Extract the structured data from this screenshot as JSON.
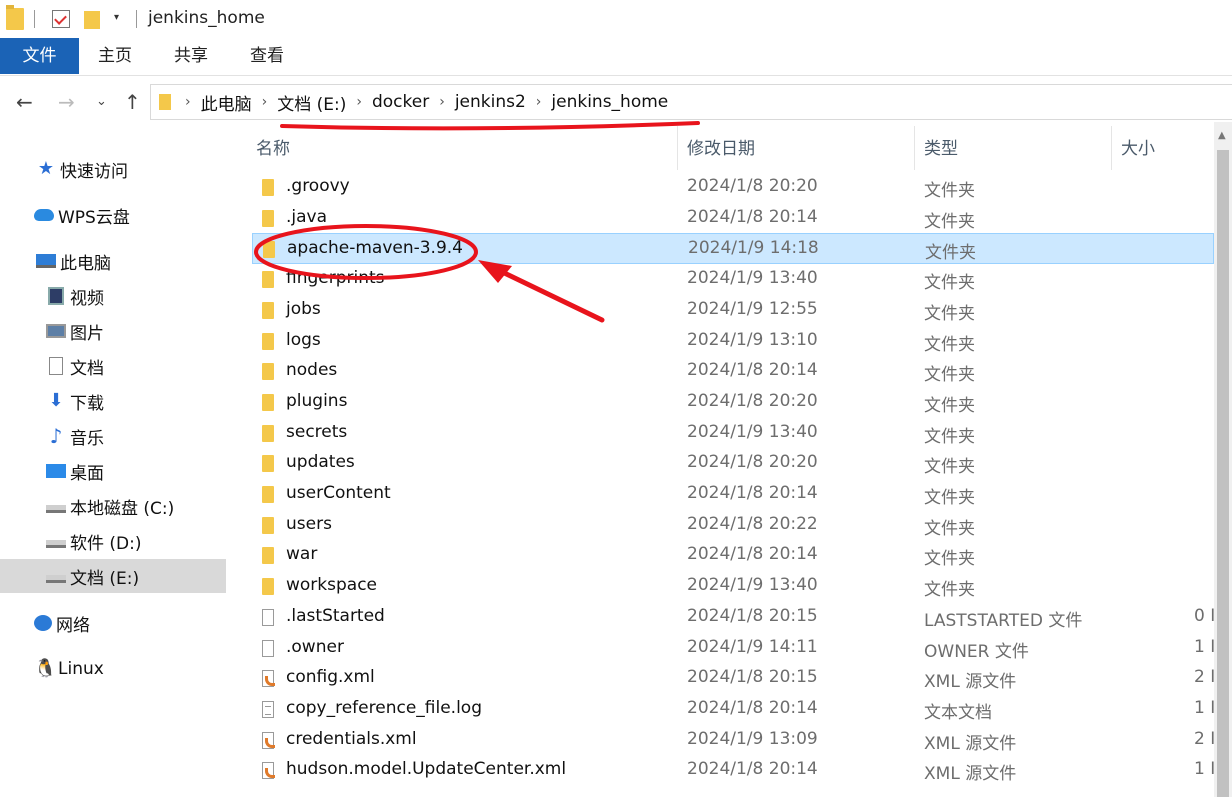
{
  "window": {
    "title": "jenkins_home"
  },
  "ribbon": {
    "tabs": [
      "文件",
      "主页",
      "共享",
      "查看"
    ]
  },
  "address": {
    "crumbs": [
      "此电脑",
      "文档 (E:)",
      "docker",
      "jenkins2",
      "jenkins_home"
    ]
  },
  "sidebar": {
    "items": [
      {
        "label": "快速访问",
        "icon": "star-icon"
      },
      {
        "label": "WPS云盘",
        "icon": "cloud-icon"
      },
      {
        "label": "此电脑",
        "icon": "computer-icon"
      },
      {
        "label": "视频",
        "icon": "video-icon"
      },
      {
        "label": "图片",
        "icon": "pictures-icon"
      },
      {
        "label": "文档",
        "icon": "documents-icon"
      },
      {
        "label": "下载",
        "icon": "download-icon"
      },
      {
        "label": "音乐",
        "icon": "music-icon"
      },
      {
        "label": "桌面",
        "icon": "desktop-icon"
      },
      {
        "label": "本地磁盘 (C:)",
        "icon": "drive-icon"
      },
      {
        "label": "软件 (D:)",
        "icon": "drive-icon"
      },
      {
        "label": "文档 (E:)",
        "icon": "drive-icon"
      },
      {
        "label": "网络",
        "icon": "network-icon"
      },
      {
        "label": "Linux",
        "icon": "linux-icon"
      }
    ]
  },
  "list": {
    "columns": {
      "name": "名称",
      "date": "修改日期",
      "type": "类型",
      "size": "大小"
    },
    "rows": [
      {
        "name": ".groovy",
        "date": "2024/1/8 20:20",
        "type": "文件夹",
        "size": "",
        "kind": "folder"
      },
      {
        "name": ".java",
        "date": "2024/1/8 20:14",
        "type": "文件夹",
        "size": "",
        "kind": "folder"
      },
      {
        "name": "apache-maven-3.9.4",
        "date": "2024/1/9 14:18",
        "type": "文件夹",
        "size": "",
        "kind": "folder",
        "selected": true
      },
      {
        "name": "fingerprints",
        "date": "2024/1/9 13:40",
        "type": "文件夹",
        "size": "",
        "kind": "folder"
      },
      {
        "name": "jobs",
        "date": "2024/1/9 12:55",
        "type": "文件夹",
        "size": "",
        "kind": "folder"
      },
      {
        "name": "logs",
        "date": "2024/1/9 13:10",
        "type": "文件夹",
        "size": "",
        "kind": "folder"
      },
      {
        "name": "nodes",
        "date": "2024/1/8 20:14",
        "type": "文件夹",
        "size": "",
        "kind": "folder"
      },
      {
        "name": "plugins",
        "date": "2024/1/8 20:20",
        "type": "文件夹",
        "size": "",
        "kind": "folder"
      },
      {
        "name": "secrets",
        "date": "2024/1/9 13:40",
        "type": "文件夹",
        "size": "",
        "kind": "folder"
      },
      {
        "name": "updates",
        "date": "2024/1/8 20:20",
        "type": "文件夹",
        "size": "",
        "kind": "folder"
      },
      {
        "name": "userContent",
        "date": "2024/1/8 20:14",
        "type": "文件夹",
        "size": "",
        "kind": "folder"
      },
      {
        "name": "users",
        "date": "2024/1/8 20:22",
        "type": "文件夹",
        "size": "",
        "kind": "folder"
      },
      {
        "name": "war",
        "date": "2024/1/8 20:14",
        "type": "文件夹",
        "size": "",
        "kind": "folder"
      },
      {
        "name": "workspace",
        "date": "2024/1/9 13:40",
        "type": "文件夹",
        "size": "",
        "kind": "folder"
      },
      {
        "name": ".lastStarted",
        "date": "2024/1/8 20:15",
        "type": "LASTSTARTED 文件",
        "size": "0 I",
        "kind": "file"
      },
      {
        "name": ".owner",
        "date": "2024/1/9 14:11",
        "type": "OWNER 文件",
        "size": "1 I",
        "kind": "file"
      },
      {
        "name": "config.xml",
        "date": "2024/1/8 20:15",
        "type": "XML 源文件",
        "size": "2 I",
        "kind": "xml"
      },
      {
        "name": "copy_reference_file.log",
        "date": "2024/1/8 20:14",
        "type": "文本文档",
        "size": "1 I",
        "kind": "txt"
      },
      {
        "name": "credentials.xml",
        "date": "2024/1/9 13:09",
        "type": "XML 源文件",
        "size": "2 I",
        "kind": "xml"
      },
      {
        "name": "hudson.model.UpdateCenter.xml",
        "date": "2024/1/8 20:14",
        "type": "XML 源文件",
        "size": "1 I",
        "kind": "xml"
      }
    ]
  },
  "colors": {
    "ribbon_file_tab": "#1b63b6",
    "selection_bg": "#cce8ff",
    "annotation_red": "#e8141c",
    "folder_yellow": "#f4c84a"
  }
}
